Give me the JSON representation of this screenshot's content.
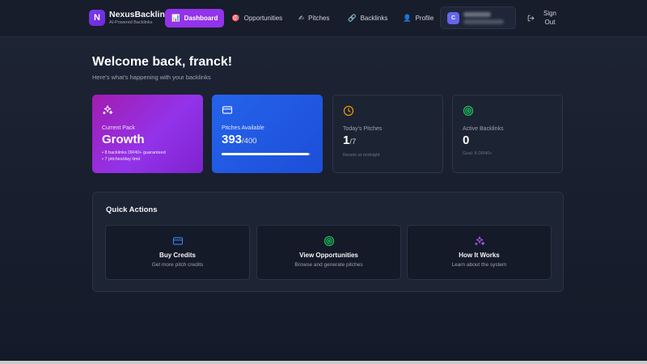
{
  "brand": {
    "logo_letter": "N",
    "name": "NexusBacklinks",
    "tagline": "AI-Powered Backlinks"
  },
  "nav": {
    "items": [
      {
        "label": "Dashboard",
        "icon": "chart-icon",
        "glyph": "📊",
        "active": true
      },
      {
        "label": "Opportunities",
        "icon": "target-dart-icon",
        "glyph": "🎯",
        "active": false
      },
      {
        "label": "Pitches",
        "icon": "writing-hand-icon",
        "glyph": "✍",
        "active": false
      },
      {
        "label": "Backlinks",
        "icon": "link-icon",
        "glyph": "🔗",
        "active": false
      },
      {
        "label": "Profile",
        "icon": "user-icon",
        "glyph": "👤",
        "active": false
      }
    ],
    "user_initial": "C",
    "signout_label": "Sign Out"
  },
  "header": {
    "title": "Welcome back, franck!",
    "subtitle": "Here's what's happening with your backlinks"
  },
  "stats": {
    "pack": {
      "label": "Current Pack",
      "value": "Growth",
      "bullets": [
        "• 8 backlinks DR40+ guaranteed",
        "• 7 pitches/day limit"
      ],
      "icon": "sparkles-icon"
    },
    "pitches": {
      "label": "Pitches Available",
      "value": "393",
      "total": "/400",
      "progress": 0.9825,
      "icon": "credit-card-icon"
    },
    "today": {
      "label": "Today's Pitches",
      "value": "1",
      "total": "/7",
      "note": "Resets at midnight",
      "icon": "clock-icon"
    },
    "active": {
      "label": "Active Backlinks",
      "value": "0",
      "note": "Goal: 8 DR40+",
      "icon": "target-icon"
    }
  },
  "quick_actions": {
    "title": "Quick Actions",
    "items": [
      {
        "name": "Buy Credits",
        "desc": "Get more pitch credits",
        "icon": "credit-card-icon"
      },
      {
        "name": "View Opportunities",
        "desc": "Browse and generate pitches",
        "icon": "target-icon"
      },
      {
        "name": "How It Works",
        "desc": "Learn about the system",
        "icon": "sparkles-icon"
      }
    ]
  },
  "colors": {
    "accent_purple": "#9333ea",
    "accent_blue": "#2563eb",
    "amber": "#f59e0b",
    "green": "#22c55e"
  }
}
